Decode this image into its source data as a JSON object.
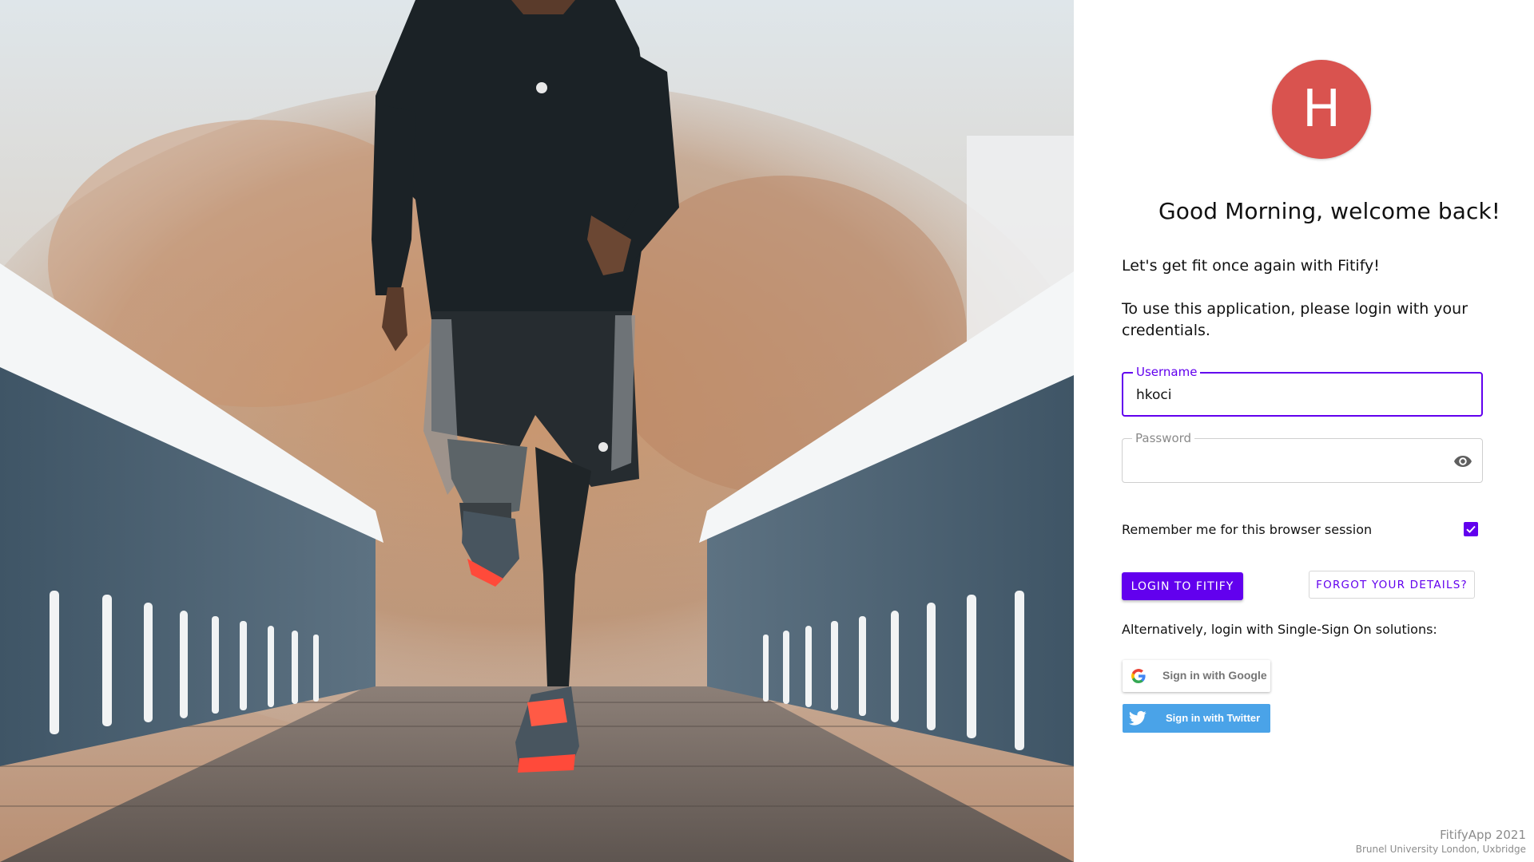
{
  "hero": {
    "image": "runner-on-bridge-photo"
  },
  "avatar": {
    "initial": "H",
    "color": "#d9534f"
  },
  "login": {
    "greeting": "Good Morning, welcome back!",
    "intro": "Let's get fit once again with Fitify!",
    "instructions": "To use this application, please login with your credentials.",
    "username": {
      "label": "Username",
      "value": "hkoci"
    },
    "password": {
      "label": "Password",
      "value": "",
      "toggle_icon": "eye-icon"
    },
    "remember": {
      "label": "Remember me for this browser session",
      "checked": true
    },
    "login_button": "LOGIN TO FITIFY",
    "forgot_button": "FORGOT YOUR DETAILS?",
    "sso_text": "Alternatively, login with Single-Sign On solutions:",
    "google_button": "Sign in with Google",
    "twitter_button": "Sign in with Twitter"
  },
  "footer": {
    "line1": "FitifyApp 2021",
    "line2": "Brunel University London, Uxbridge"
  },
  "colors": {
    "accent": "#6200ee",
    "twitter": "#4aa3e8",
    "avatar": "#d9534f"
  }
}
